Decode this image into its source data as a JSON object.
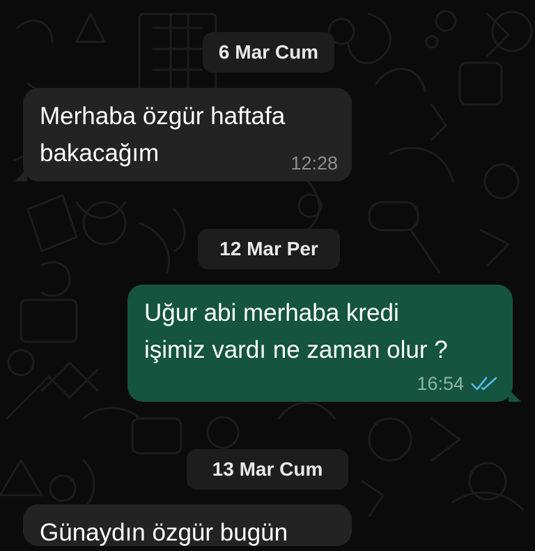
{
  "chat": {
    "dates": [
      "6 Mar Cum",
      "12 Mar Per",
      "13 Mar Cum"
    ],
    "messages": [
      {
        "direction": "incoming",
        "text": "Merhaba özgür haftafa\nbakacağım",
        "time": "12:28"
      },
      {
        "direction": "outgoing",
        "text": "Uğur abi merhaba kredi\nişimiz vardı ne zaman olur ?",
        "time": "16:54",
        "status_icon": "double-check-read-icon"
      },
      {
        "direction": "incoming",
        "text": "Günaydın özgür bugün",
        "time": ""
      }
    ]
  },
  "colors": {
    "background": "#0b0b0b",
    "incoming_bubble": "#232323",
    "outgoing_bubble": "#15543f",
    "date_chip": "#1d1d1d",
    "read_ticks": "#53bdeb"
  }
}
